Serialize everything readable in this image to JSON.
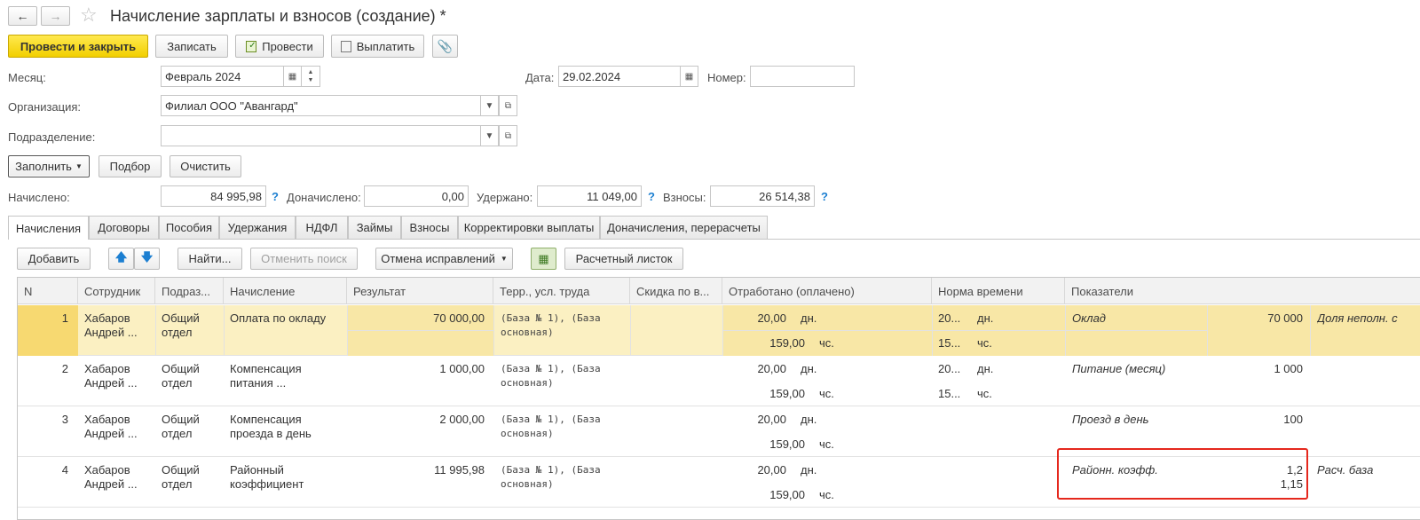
{
  "window": {
    "title": "Начисление зарплаты и взносов (создание) *"
  },
  "toolbar": {
    "post_close": "Провести и закрыть",
    "save": "Записать",
    "post": "Провести",
    "pay": "Выплатить"
  },
  "form": {
    "month_label": "Месяц:",
    "month_value": "Февраль 2024",
    "date_label": "Дата:",
    "date_value": "29.02.2024",
    "number_label": "Номер:",
    "number_value": "",
    "org_label": "Организация:",
    "org_value": "Филиал ООО \"Авангард\"",
    "dept_label": "Подразделение:",
    "dept_value": ""
  },
  "actions": {
    "fill": "Заполнить",
    "pick": "Подбор",
    "clear": "Очистить"
  },
  "totals": {
    "accrued_label": "Начислено:",
    "accrued": "84 995,98",
    "extra_label": "Доначислено:",
    "extra": "0,00",
    "withheld_label": "Удержано:",
    "withheld": "11 049,00",
    "contrib_label": "Взносы:",
    "contrib": "26 514,38",
    "help": "?"
  },
  "tabs": [
    "Начисления",
    "Договоры",
    "Пособия",
    "Удержания",
    "НДФЛ",
    "Займы",
    "Взносы",
    "Корректировки выплаты",
    "Доначисления, перерасчеты"
  ],
  "grid_toolbar": {
    "add": "Добавить",
    "find": "Найти...",
    "cancel_search": "Отменить поиск",
    "cancel_fix": "Отмена исправлений",
    "payslip": "Расчетный листок"
  },
  "columns": [
    "N",
    "Сотрудник",
    "Подраз...",
    "Начисление",
    "Результат",
    "Терр., усл. труда",
    "Скидка по в...",
    "Отработано (оплачено)",
    "Норма времени",
    "Показатели"
  ],
  "rows": [
    {
      "n": "1",
      "emp1": "Хабаров",
      "emp2": "Андрей ...",
      "dep1": "Общий",
      "dep2": "отдел",
      "acc1": "Оплата по окладу",
      "acc2": "",
      "result": "70 000,00",
      "terr1": "(База № 1), (База",
      "terr2": "основная)",
      "days": "20,00",
      "days_unit": "дн.",
      "hours": "159,00",
      "hours_unit": "чс.",
      "norm_days": "20...",
      "norm_days_unit": "дн.",
      "norm_hours": "15...",
      "norm_hours_unit": "чс.",
      "ind_name": "Оклад",
      "ind_val1": "70 000",
      "ind_val2": "",
      "extra": "Доля неполн. с"
    },
    {
      "n": "2",
      "emp1": "Хабаров",
      "emp2": "Андрей ...",
      "dep1": "Общий",
      "dep2": "отдел",
      "acc1": "Компенсация",
      "acc2": "питания ...",
      "result": "1 000,00",
      "terr1": "(База № 1), (База",
      "terr2": "основная)",
      "days": "20,00",
      "days_unit": "дн.",
      "hours": "159,00",
      "hours_unit": "чс.",
      "norm_days": "20...",
      "norm_days_unit": "дн.",
      "norm_hours": "15...",
      "norm_hours_unit": "чс.",
      "ind_name": "Питание (месяц)",
      "ind_val1": "1 000",
      "ind_val2": "",
      "extra": ""
    },
    {
      "n": "3",
      "emp1": "Хабаров",
      "emp2": "Андрей ...",
      "dep1": "Общий",
      "dep2": "отдел",
      "acc1": "Компенсация",
      "acc2": "проезда в день",
      "result": "2 000,00",
      "terr1": "(База № 1), (База",
      "terr2": "основная)",
      "days": "20,00",
      "days_unit": "дн.",
      "hours": "159,00",
      "hours_unit": "чс.",
      "norm_days": "",
      "norm_days_unit": "",
      "norm_hours": "",
      "norm_hours_unit": "",
      "ind_name": "Проезд в день",
      "ind_val1": "100",
      "ind_val2": "",
      "extra": ""
    },
    {
      "n": "4",
      "emp1": "Хабаров",
      "emp2": "Андрей ...",
      "dep1": "Общий",
      "dep2": "отдел",
      "acc1": "Районный",
      "acc2": "коэффициент",
      "result": "11 995,98",
      "terr1": "(База № 1), (База",
      "terr2": "основная)",
      "days": "20,00",
      "days_unit": "дн.",
      "hours": "159,00",
      "hours_unit": "чс.",
      "norm_days": "",
      "norm_days_unit": "",
      "norm_hours": "",
      "norm_hours_unit": "",
      "ind_name": "Районн. коэфф.",
      "ind_val1": "1,2",
      "ind_val2": "1,15",
      "extra": "Расч. база"
    }
  ],
  "colors": {
    "accent_yellow": "#f2cf00",
    "selected_row": "#fbf0c2",
    "highlight_red": "#e5281d",
    "help_blue": "#1c7fd1"
  }
}
